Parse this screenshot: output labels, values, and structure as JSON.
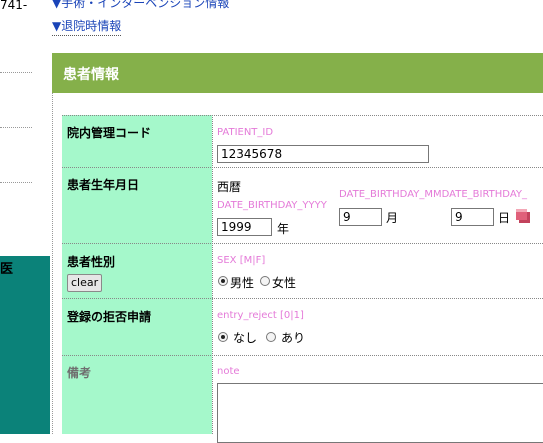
{
  "sidebar": {
    "code_fragment": "741-",
    "teal_char": "医"
  },
  "nav_links": {
    "surgery": "▼手術・インターベンション情報",
    "discharge": "▼退院時情報"
  },
  "section": {
    "title": "患者情報"
  },
  "form": {
    "patient_id": {
      "label": "院内管理コード",
      "key": "PATIENT_ID",
      "value": "12345678"
    },
    "birthday": {
      "label": "患者生年月日",
      "era": "西暦",
      "key_yyyy": "DATE_BIRTHDAY_YYYY",
      "key_mm_dd": "DATE_BIRTHDAY_MMDATE_BIRTHDAY_",
      "year_value": "1999",
      "year_unit": "年",
      "month_value": "9",
      "month_unit": "月",
      "day_value": "9",
      "day_unit": "日"
    },
    "sex": {
      "label": "患者性別",
      "clear_button": "clear",
      "key": "SEX [M|F]",
      "option_male": "男性",
      "option_female": "女性",
      "selected": "男性"
    },
    "entry_reject": {
      "label": "登録の拒否申請",
      "key": "entry_reject [0|1]",
      "option_none": "なし",
      "option_yes": "あり",
      "selected": "なし"
    },
    "note": {
      "label": "備考",
      "key": "note",
      "value": ""
    }
  },
  "colors": {
    "band": "#85b04a",
    "label_column": "#a5f8cb",
    "teal_panel": "#0b8279",
    "key_text": "#e47ad8",
    "link": "#1a44b8"
  },
  "icons": {
    "calendar": "calendar-icon"
  }
}
